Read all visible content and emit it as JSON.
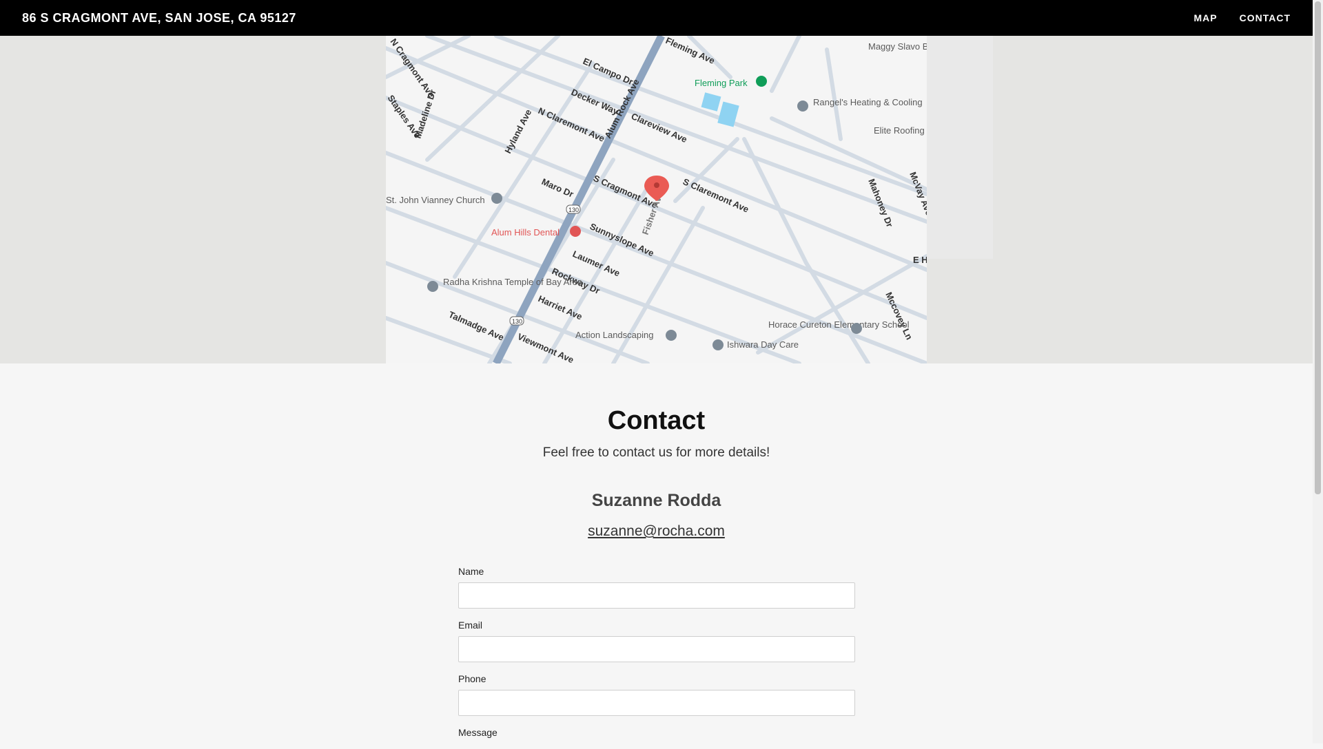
{
  "header": {
    "title": "86 S CRAGMONT AVE, SAN JOSE, CA 95127",
    "nav": [
      "MAP",
      "CONTACT"
    ]
  },
  "map": {
    "roads": [
      "N Cragmont Ave",
      "Fleming Ave",
      "Alum Rock Ave",
      "El Campo Dr",
      "Decker Way",
      "Clareview Ave",
      "N Claremont Ave",
      "Hyland Ave",
      "Madeline Dr",
      "Staples Ave",
      "S Claremont Ave",
      "S Cragmont Ave",
      "Maro Dr",
      "Sunnyslope Ave",
      "Laumer Ave",
      "Rockway Dr",
      "Harriet Ave",
      "Talmadge Ave",
      "Viewmont Ave",
      "Fisher Ave",
      "Mahoney Dr",
      "McVay Ave",
      "Mccovey Ln",
      "E Hi",
      "JN Re",
      "Fle"
    ],
    "places": [
      "Fleming Park",
      "Rangel's Heating & Cooling",
      "Elite Roofing",
      "Maggy Slavo Broker/Real",
      "St. John Vianney Church",
      "Alum Hills Dental",
      "Radha Krishna Temple of Bay Area",
      "Action Landscaping",
      "Ishwara Day Care",
      "Horace Cureton Elementary School"
    ],
    "route_shield": "130",
    "colors": {
      "land": "#f5f5f5",
      "road": "#c9d3de",
      "highway": "#8ea4bf",
      "park": "#0f9d58",
      "dental": "#e15555",
      "pin": "#ea5b54",
      "water": "#8fd3f2"
    }
  },
  "contact": {
    "heading": "Contact",
    "subtitle": "Feel free to contact us for more details!",
    "name": "Suzanne Rodda",
    "email": "suzanne@rocha.com"
  },
  "form": {
    "name_label": "Name",
    "email_label": "Email",
    "phone_label": "Phone",
    "message_label": "Message"
  }
}
